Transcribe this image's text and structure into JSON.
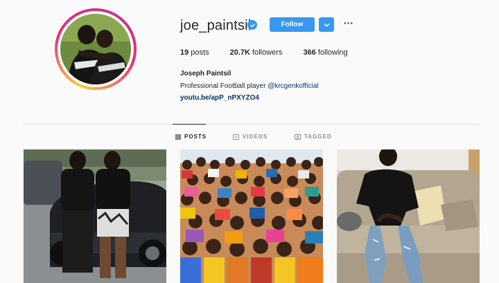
{
  "profile": {
    "username": "joe_paintsil",
    "full_name": "Joseph Paintsil",
    "bio_text": "Professional Football player ",
    "bio_mention": "@krcgenkofficial",
    "link": "youtu.be/apP_nPXYZO4"
  },
  "actions": {
    "follow_label": "Follow",
    "more_label": "···"
  },
  "stats": {
    "posts_count": "19",
    "posts_label": " posts",
    "followers_count": "20.7K",
    "followers_label": " followers",
    "following_count": "366",
    "following_label": " following"
  },
  "tabs": [
    {
      "label": "POSTS",
      "icon": "grid-icon",
      "active": true
    },
    {
      "label": "VIDEOS",
      "icon": "video-icon",
      "active": false
    },
    {
      "label": "TAGGED",
      "icon": "tag-icon",
      "active": false
    }
  ],
  "colors": {
    "accent": "#3897f0",
    "link": "#00376b"
  }
}
